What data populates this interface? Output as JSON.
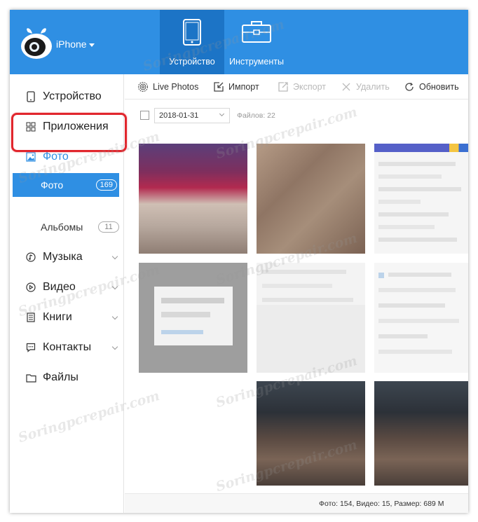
{
  "header": {
    "device_name": "iPhone",
    "tabs": [
      {
        "label": "Устройство",
        "icon": "tablet-icon",
        "active": true
      },
      {
        "label": "Инструменты",
        "icon": "toolbox-icon",
        "active": false
      }
    ]
  },
  "sidebar": {
    "items": [
      {
        "label": "Устройство",
        "icon": "phone-icon"
      },
      {
        "label": "Приложения",
        "icon": "apps-grid-icon"
      },
      {
        "label": "Фото",
        "icon": "photo-icon",
        "accent": true
      },
      {
        "label": "Музыка",
        "icon": "music-icon"
      },
      {
        "label": "Видео",
        "icon": "video-icon"
      },
      {
        "label": "Книги",
        "icon": "book-icon"
      },
      {
        "label": "Контакты",
        "icon": "contacts-icon"
      },
      {
        "label": "Файлы",
        "icon": "folder-icon"
      }
    ],
    "sub_items": [
      {
        "label": "Фото",
        "count": "169",
        "active": true
      },
      {
        "label": "Альбомы",
        "count": "11",
        "active": false
      }
    ]
  },
  "toolbar": {
    "live_photos": "Live Photos",
    "import": "Импорт",
    "export": "Экспорт",
    "delete": "Удалить",
    "refresh": "Обновить"
  },
  "filter": {
    "date": "2018-01-31",
    "files_count": "Файлов: 22"
  },
  "status": {
    "text": "Фото: 154, Видео: 15, Размер: 689 М"
  },
  "watermark": "Soringpcrepair.com",
  "colors": {
    "accent": "#2f8fe3",
    "header_active": "#1c74c6",
    "highlight": "#e1262d"
  }
}
